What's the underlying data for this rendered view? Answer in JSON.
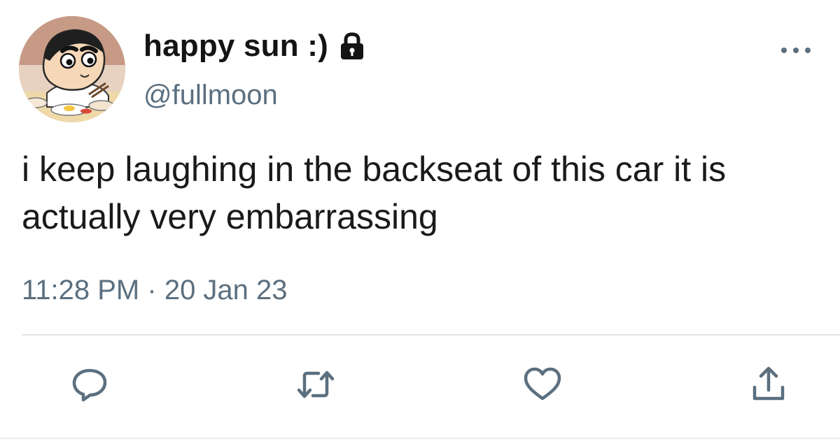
{
  "user": {
    "display_name": "happy sun :)",
    "handle": "@fullmoon",
    "protected": true
  },
  "tweet": {
    "text": "i keep laughing in the backseat of this car it is actually very embarrassing",
    "time": "11:28 PM",
    "separator": "·",
    "date": "20 Jan 23"
  },
  "actions": {
    "reply_icon": "reply-icon",
    "retweet_icon": "retweet-icon",
    "like_icon": "heart-icon",
    "share_icon": "share-icon"
  },
  "colors": {
    "text": "#1a1a1a",
    "secondary": "#5b6f7f",
    "divider": "#e3e7ea"
  }
}
